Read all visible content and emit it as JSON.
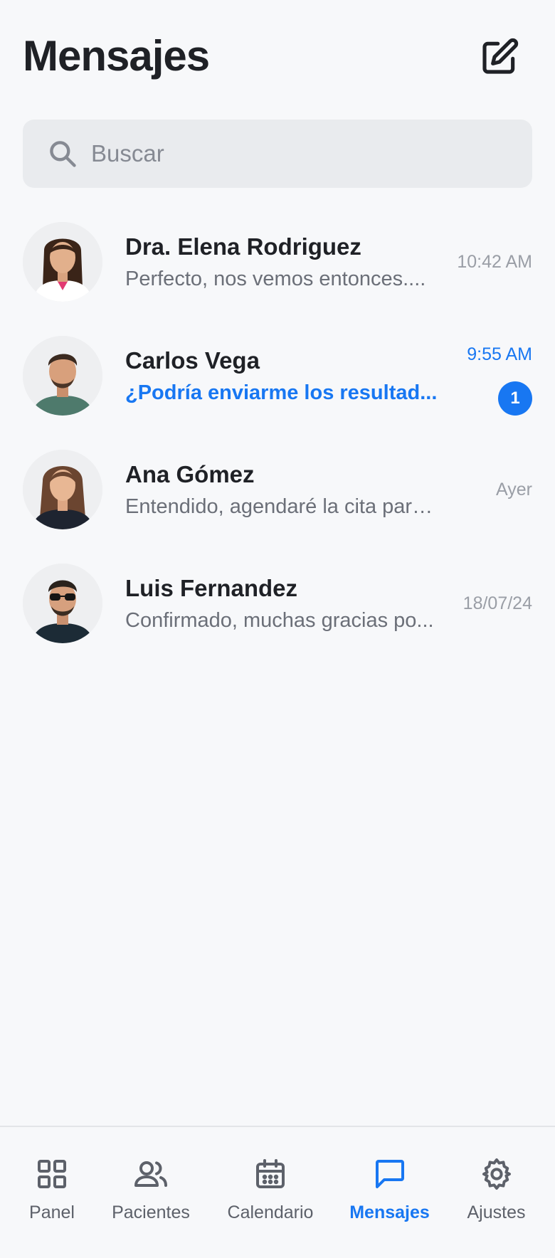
{
  "header": {
    "title": "Mensajes",
    "compose_icon": "edit-square-icon"
  },
  "search": {
    "placeholder": "Buscar",
    "value": "",
    "icon": "search-icon"
  },
  "conversations": [
    {
      "name": "Dra. Elena Rodriguez",
      "preview": "Perfecto, nos vemos entonces....",
      "time": "10:42 AM",
      "unread": false,
      "unread_count": null
    },
    {
      "name": "Carlos Vega",
      "preview": "¿Podría enviarme los resultad...",
      "time": "9:55 AM",
      "unread": true,
      "unread_count": "1"
    },
    {
      "name": "Ana Gómez",
      "preview": "Entendido, agendaré la cita para el...",
      "time": "Ayer",
      "unread": false,
      "unread_count": null
    },
    {
      "name": "Luis Fernandez",
      "preview": "Confirmado, muchas gracias po...",
      "time": "18/07/24",
      "unread": false,
      "unread_count": null
    }
  ],
  "bottom_nav": {
    "items": [
      {
        "label": "Panel",
        "icon": "grid-icon",
        "active": false
      },
      {
        "label": "Pacientes",
        "icon": "users-icon",
        "active": false
      },
      {
        "label": "Calendario",
        "icon": "calendar-icon",
        "active": false
      },
      {
        "label": "Mensajes",
        "icon": "chat-icon",
        "active": true
      },
      {
        "label": "Ajustes",
        "icon": "gear-icon",
        "active": false
      }
    ]
  },
  "colors": {
    "accent": "#1877F2",
    "background": "#F7F8FA",
    "search_background": "#E9EBEE",
    "text_primary": "#1F2126",
    "text_secondary": "#6B6F78"
  }
}
